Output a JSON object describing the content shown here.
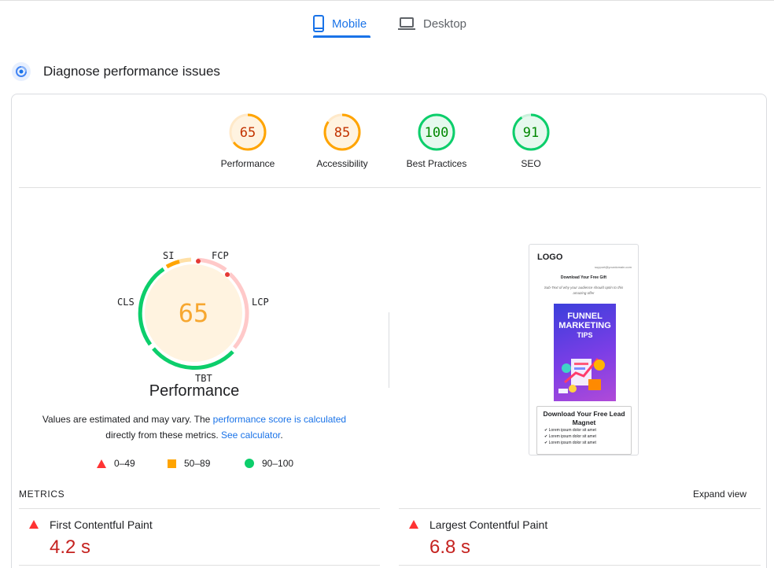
{
  "tabs": [
    {
      "label": "Mobile",
      "icon": "smartphone-icon",
      "active": true
    },
    {
      "label": "Desktop",
      "icon": "laptop-icon",
      "active": false
    }
  ],
  "section_title": "Diagnose performance issues",
  "colors": {
    "accent": "#1a73e8",
    "fail": "#ff3333",
    "average": "#ffa400",
    "pass": "#0cce6b",
    "average_text": "#c33300",
    "pass_text": "#008800"
  },
  "scores": [
    {
      "label": "Performance",
      "value": "65",
      "status": "average"
    },
    {
      "label": "Accessibility",
      "value": "85",
      "status": "average"
    },
    {
      "label": "Best Practices",
      "value": "100",
      "status": "pass"
    },
    {
      "label": "SEO",
      "value": "91",
      "status": "pass"
    }
  ],
  "performance_gauge": {
    "score": "65",
    "title": "Performance",
    "metrics": {
      "si": "SI",
      "fcp": "FCP",
      "lcp": "LCP",
      "tbt": "TBT",
      "cls": "CLS"
    }
  },
  "disclaimer": {
    "prefix": "Values are estimated and may vary. The ",
    "link1": "performance score is calculated",
    "middle": "directly from these metrics. ",
    "link2": "See calculator",
    "suffix": "."
  },
  "legend": [
    {
      "shape": "triangle",
      "range": "0–49"
    },
    {
      "shape": "square",
      "range": "50–89"
    },
    {
      "shape": "circle",
      "range": "90–100"
    }
  ],
  "thumbnail": {
    "logo": "LOGO",
    "email": "support@yourdomain.com",
    "heading": "Download Your Free Gift",
    "subtext": "Sub-Text of why your audience should optin to this amazing offer",
    "book_title": "FUNNEL MARKETING",
    "book_sub": "TIPS",
    "box_title": "Download Your Free Lead Magnet",
    "checks": [
      "Lorem ipsum dolor sit amet",
      "Lorem ipsum dolor sit amet",
      "Lorem ipsum dolor sit amet"
    ]
  },
  "metrics": {
    "header": "METRICS",
    "expand_label": "Expand view",
    "items": [
      {
        "name": "First Contentful Paint",
        "value": "4.2 s"
      },
      {
        "name": "Largest Contentful Paint",
        "value": "6.8 s"
      }
    ]
  }
}
